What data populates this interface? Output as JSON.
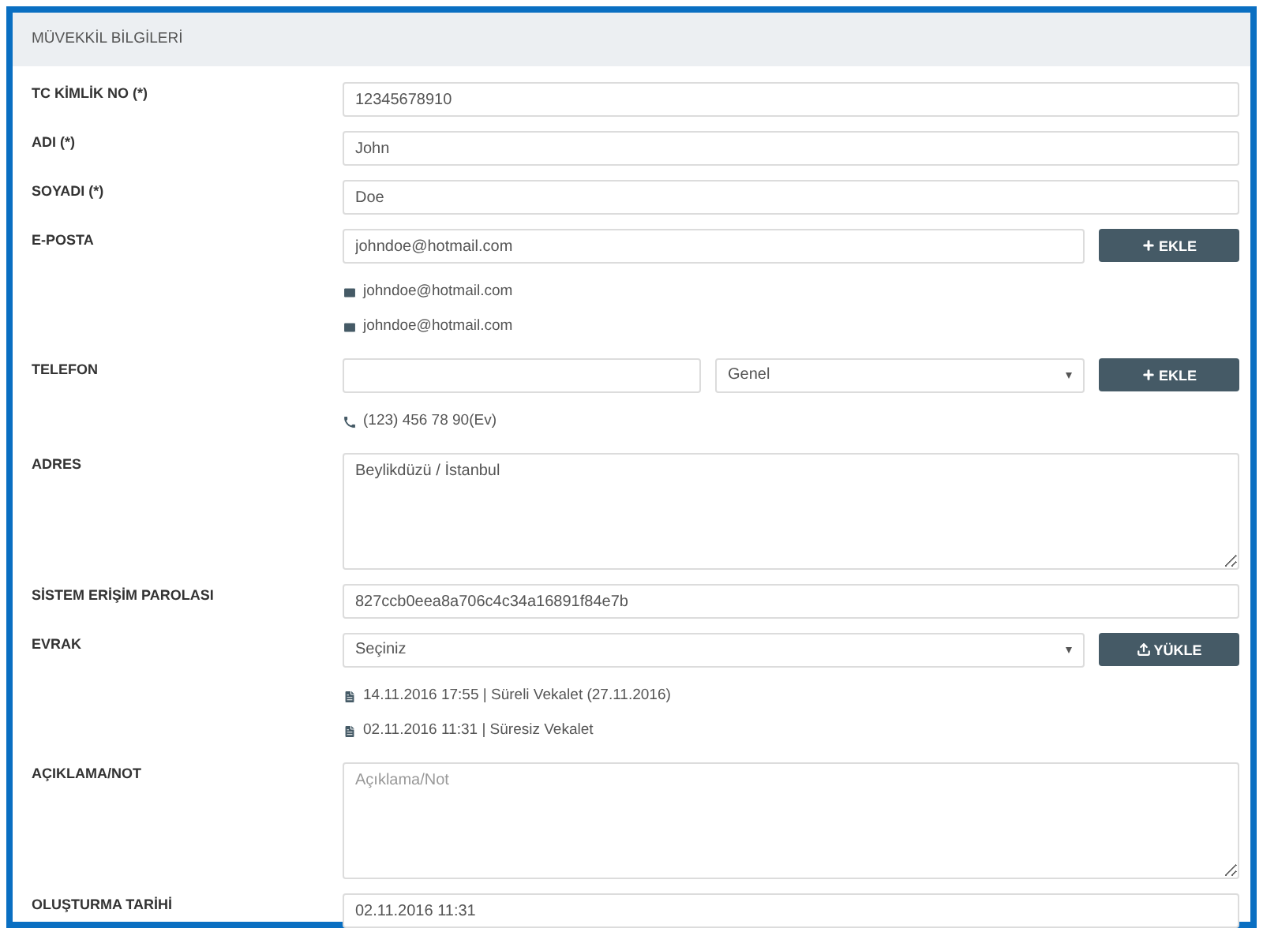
{
  "section_title": "MÜVEKKİL BİLGİLERİ",
  "fields": [
    {
      "kind": "text",
      "label": "TC KİMLİK NO (*)",
      "value": "12345678910"
    },
    {
      "kind": "text",
      "label": "ADI (*)",
      "value": "John"
    },
    {
      "kind": "text",
      "label": "SOYADI (*)",
      "value": "Doe"
    },
    {
      "kind": "email",
      "label": "E-POSTA",
      "value": "johndoe@hotmail.com",
      "button": "EKLE",
      "items": [
        "johndoe@hotmail.com",
        "johndoe@hotmail.com"
      ]
    },
    {
      "kind": "phone",
      "label": "TELEFON",
      "select": "Genel",
      "button": "EKLE",
      "items": [
        "(123) 456 78 90(Ev)"
      ]
    },
    {
      "kind": "textarea",
      "label": "ADRES",
      "value": "Beylikdüzü / İstanbul"
    },
    {
      "kind": "text",
      "label": "SİSTEM ERİŞİM PAROLASI",
      "value": "827ccb0eea8a706c4c34a16891f84e7b"
    },
    {
      "kind": "upload",
      "label": "EVRAK",
      "select": "Seçiniz",
      "button": "YÜKLE",
      "items": [
        "14.11.2016 17:55 | Süreli Vekalet (27.11.2016)",
        "02.11.2016 11:31 | Süresiz Vekalet"
      ]
    },
    {
      "kind": "textarea",
      "label": "AÇIKLAMA/NOT",
      "placeholder": "Açıklama/Not"
    },
    {
      "kind": "text",
      "label": "OLUŞTURMA TARİHİ",
      "value": "02.11.2016 11:31"
    }
  ]
}
